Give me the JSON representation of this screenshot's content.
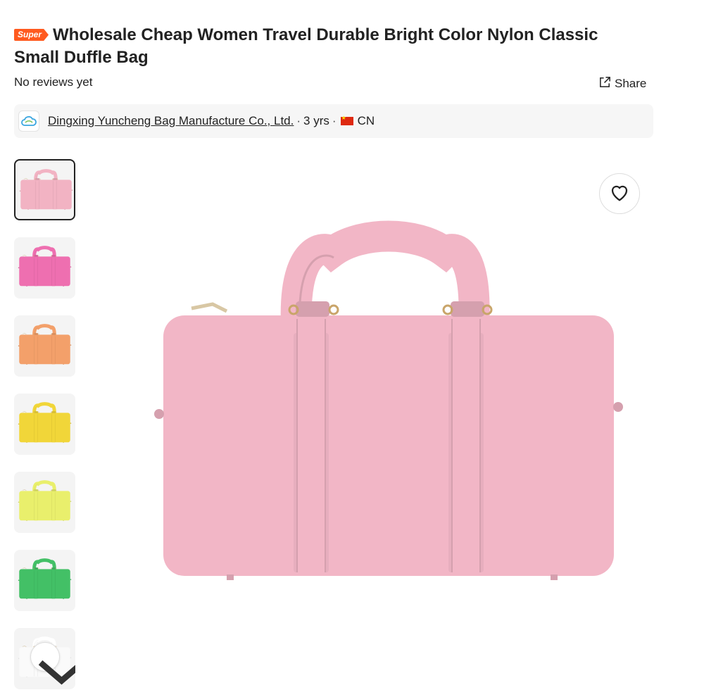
{
  "product": {
    "badge": "Super",
    "title": "Wholesale Cheap Women Travel Durable Bright Color Nylon Classic Small Duffle Bag",
    "reviews": "No reviews yet",
    "share_label": "Share"
  },
  "supplier": {
    "name": "Dingxing Yuncheng Bag Manufacture Co., Ltd.",
    "years": "3 yrs",
    "country": "CN",
    "logo_icon": "cloud-logo-icon"
  },
  "gallery": {
    "thumbnails": [
      {
        "color": "#f2b3c3",
        "label": "pink"
      },
      {
        "color": "#ee6fb0",
        "label": "hot pink"
      },
      {
        "color": "#f3a06a",
        "label": "orange"
      },
      {
        "color": "#f1d639",
        "label": "yellow"
      },
      {
        "color": "#e9ef6c",
        "label": "lime"
      },
      {
        "color": "#43c066",
        "label": "green"
      },
      {
        "color": "#f4f4f4",
        "label": "white"
      }
    ],
    "selected_index": 0,
    "main_color": "#f2b6c6",
    "favorite_icon": "heart-icon",
    "scroll_icon": "chevron-down-icon"
  },
  "colors": {
    "badge": "#ff5a1f",
    "text": "#222222"
  }
}
